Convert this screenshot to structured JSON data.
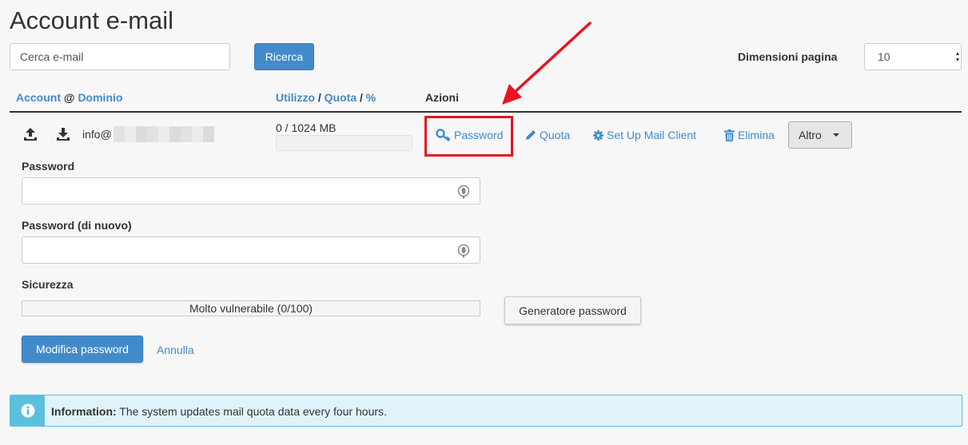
{
  "page": {
    "title": "Account e-mail"
  },
  "search": {
    "placeholder": "Cerca e-mail",
    "button_label": "Ricerca"
  },
  "page_size": {
    "label": "Dimensioni pagina",
    "value": "10"
  },
  "table": {
    "headers": {
      "account": "Account",
      "at": "@",
      "domain": "Dominio",
      "usage": "Utilizzo",
      "slash1": "/",
      "quota": "Quota",
      "slash2": "/",
      "percent": "%",
      "actions": "Azioni"
    },
    "row": {
      "email_user": "info@",
      "usage_text": "0 / 1024 MB",
      "usage_fraction": 0,
      "actions": {
        "password": "Password",
        "quota": "Quota",
        "setup": "Set Up Mail Client",
        "delete": "Elimina",
        "more": "Altro"
      }
    }
  },
  "form": {
    "password_label": "Password",
    "password_again_label": "Password (di nuovo)",
    "security_label": "Sicurezza",
    "strength_text": "Molto vulnerabile (0/100)",
    "strength_value": 0,
    "generator_button": "Generatore password",
    "submit_button": "Modifica password",
    "cancel_link": "Annulla"
  },
  "info": {
    "label": "Information:",
    "message": "The system updates mail quota data every four hours."
  },
  "colors": {
    "link": "#428bca",
    "primary_button": "#428bca",
    "highlight": "#e8141e",
    "info_bg": "#e1f3fa",
    "info_accent": "#5bc0de"
  }
}
